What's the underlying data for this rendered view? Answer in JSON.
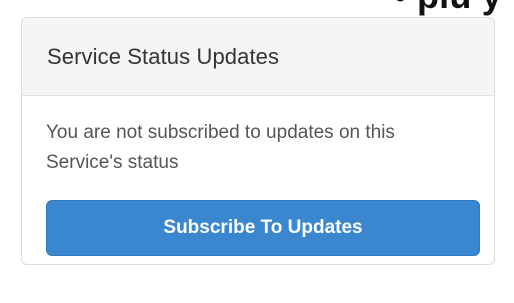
{
  "top_cut_text": "• plu y",
  "panel": {
    "title": "Service Status Updates",
    "message": "You are not subscribed to updates on this Service's status",
    "button_label": "Subscribe To Updates"
  },
  "colors": {
    "button_background": "#3a87d0",
    "header_background": "#f5f5f5",
    "border": "#dcdcdc",
    "text": "#555555"
  }
}
